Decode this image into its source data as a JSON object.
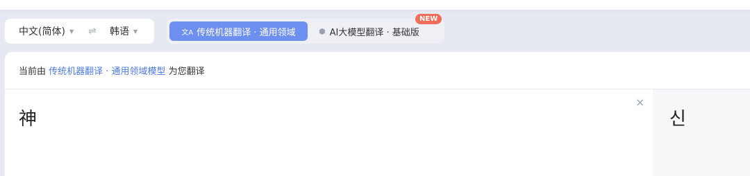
{
  "lang": {
    "source": "中文(简体)",
    "target": "韩语",
    "swap_icon": "⇌",
    "caret": "▼"
  },
  "modes": {
    "active_label": "传统机器翻译 · 通用领域",
    "active_icon": "文A",
    "ai_label": "AI大模型翻译 · 基础版",
    "ai_icon": "⬢",
    "new_badge": "NEW"
  },
  "notice": {
    "prefix": "当前由 ",
    "link": "传统机器翻译 · 通用领域模型",
    "suffix": " 为您翻译"
  },
  "source_text": "神",
  "target_text": "신",
  "clear_icon": "×",
  "colors": {
    "accent": "#6d8ff0",
    "link": "#4e7be0",
    "badge": "#f26b5b"
  }
}
